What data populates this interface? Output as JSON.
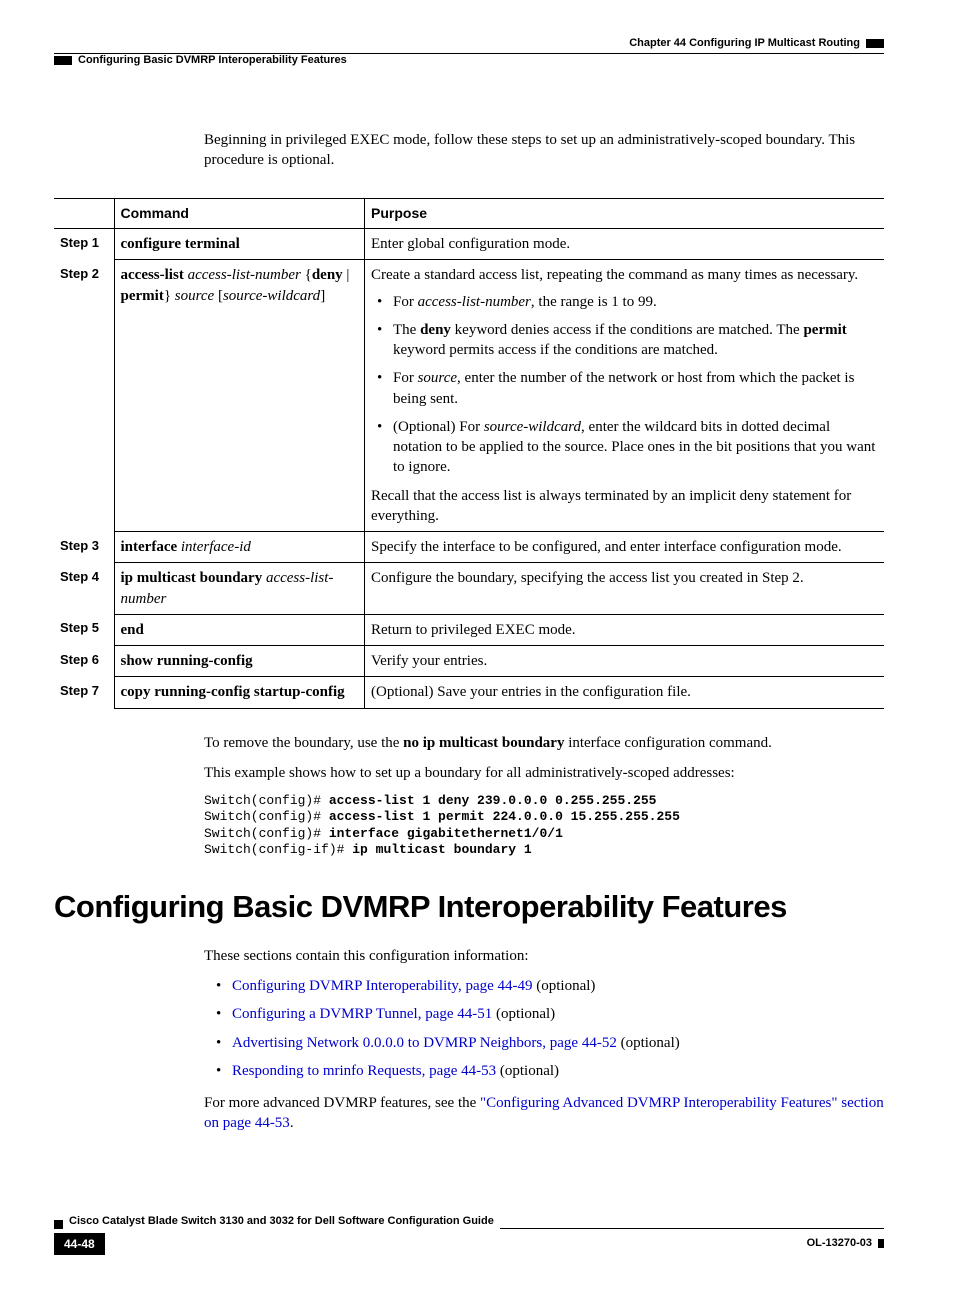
{
  "header": {
    "chapter": "Chapter 44    Configuring IP Multicast Routing",
    "section": "Configuring Basic DVMRP Interoperability Features"
  },
  "intro": "Beginning in privileged EXEC mode, follow these steps to set up an administratively-scoped boundary. This procedure is optional.",
  "table": {
    "head_cmd": "Command",
    "head_purpose": "Purpose",
    "steps": {
      "s1": {
        "label": "Step 1",
        "purpose": "Enter global configuration mode."
      },
      "s2": {
        "label": "Step 2",
        "p_intro": "Create a standard access list, repeating the command as many times as necessary.",
        "p_recall": "Recall that the access list is always terminated by an implicit deny statement for everything."
      },
      "s3": {
        "label": "Step 3",
        "purpose": "Specify the interface to be configured, and enter interface configuration mode."
      },
      "s4": {
        "label": "Step 4",
        "purpose": "Configure the boundary, specifying the access list you created in Step 2."
      },
      "s5": {
        "label": "Step 5",
        "cmd": "end",
        "purpose": "Return to privileged EXEC mode."
      },
      "s6": {
        "label": "Step 6",
        "cmd": "show running-config",
        "purpose": "Verify your entries."
      },
      "s7": {
        "label": "Step 7",
        "cmd": "copy running-config startup-config",
        "purpose": "(Optional) Save your entries in the configuration file."
      }
    }
  },
  "after": {
    "example_intro": "This example shows how to set up a boundary for all administratively-scoped addresses:",
    "code_p1": "Switch(config)# ",
    "code_c1": "access-list 1 deny 239.0.0.0 0.255.255.255",
    "code_p2": "Switch(config)# ",
    "code_c2": "access-list 1 permit 224.0.0.0 15.255.255.255",
    "code_p3": "Switch(config)# ",
    "code_c3": "interface gigabitethernet1/0/1",
    "code_p4": "Switch(config-if)# ",
    "code_c4": "ip multicast boundary 1"
  },
  "heading": "Configuring Basic DVMRP Interoperability Features",
  "toc": {
    "intro": "These sections contain this configuration information:",
    "items": [
      {
        "link": "Configuring DVMRP Interoperability, page 44-49",
        "suffix": " (optional)"
      },
      {
        "link": "Configuring a DVMRP Tunnel, page 44-51",
        "suffix": " (optional)"
      },
      {
        "link": "Advertising Network 0.0.0.0 to DVMRP Neighbors, page 44-52",
        "suffix": " (optional)"
      },
      {
        "link": "Responding to mrinfo Requests, page 44-53",
        "suffix": " (optional)"
      }
    ],
    "outro_pre": "For more advanced DVMRP features, see the ",
    "outro_link": "\"Configuring Advanced DVMRP Interoperability Features\" section on page 44-53",
    "outro_post": "."
  },
  "footer": {
    "guide": "Cisco Catalyst Blade Switch 3130 and 3032 for Dell Software Configuration Guide",
    "page": "44-48",
    "docid": "OL-13270-03"
  }
}
